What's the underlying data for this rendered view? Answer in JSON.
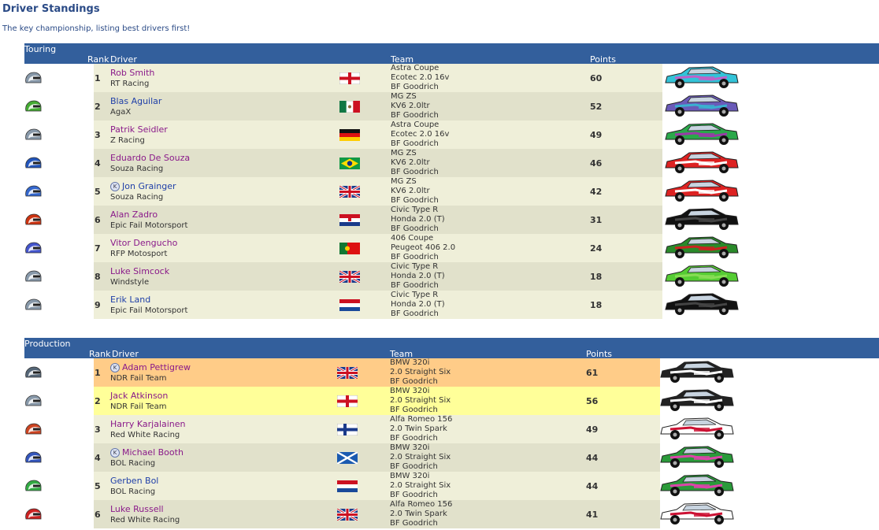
{
  "page": {
    "title": "Driver Standings",
    "subtitle": "The key championship, listing best drivers first!"
  },
  "columns": {
    "rank": "Rank",
    "driver": "Driver",
    "team": "Team",
    "points": "Points"
  },
  "colors": {
    "header": "#335f9c",
    "row_light": "#efefd9",
    "row_dark": "#e1e1cb",
    "leader": "#ffcc88",
    "second": "#ffff99",
    "name_purple": "#8a1a8a",
    "name_blue": "#1f3fa8"
  },
  "sections": [
    {
      "name": "Touring",
      "drivers": [
        {
          "rank": "1",
          "name": "Rob Smith",
          "team": "RT Racing",
          "flag": "england",
          "car": [
            "Astra Coupe",
            "Ecotec 2.0 16v",
            "BF Goodrich"
          ],
          "points": "60",
          "badge": false,
          "helmet": "#8899aa",
          "livery": [
            "#33c3d8",
            "#c060c8"
          ],
          "bg": "#efefd9",
          "name_color": "purple"
        },
        {
          "rank": "2",
          "name": "Blas Aguilar",
          "team": "AgaX",
          "flag": "mexico",
          "car": [
            "MG ZS",
            "KV6 2.0ltr",
            "BF Goodrich"
          ],
          "points": "52",
          "badge": false,
          "helmet": "#44aa33",
          "livery": [
            "#6a5ab8",
            "#3ab0d0"
          ],
          "bg": "#e1e1cb",
          "name_color": "blue"
        },
        {
          "rank": "3",
          "name": "Patrik Seidler",
          "team": "Z Racing",
          "flag": "germany",
          "car": [
            "Astra Coupe",
            "Ecotec 2.0 16v",
            "BF Goodrich"
          ],
          "points": "49",
          "badge": false,
          "helmet": "#8899aa",
          "livery": [
            "#2aa84a",
            "#9a3aa8"
          ],
          "bg": "#efefd9",
          "name_color": "purple"
        },
        {
          "rank": "4",
          "name": "Eduardo De Souza",
          "team": "Souza Racing",
          "flag": "brazil",
          "car": [
            "MG ZS",
            "KV6 2.0ltr",
            "BF Goodrich"
          ],
          "points": "46",
          "badge": false,
          "helmet": "#2255bb",
          "livery": [
            "#dd2222",
            "#ffffff"
          ],
          "bg": "#e1e1cb",
          "name_color": "purple"
        },
        {
          "rank": "5",
          "name": "Jon Grainger",
          "team": "Souza Racing",
          "flag": "uk",
          "car": [
            "MG ZS",
            "KV6 2.0ltr",
            "BF Goodrich"
          ],
          "points": "42",
          "badge": true,
          "helmet": "#3366cc",
          "livery": [
            "#dd2222",
            "#ffffff"
          ],
          "bg": "#efefd9",
          "name_color": "blue"
        },
        {
          "rank": "6",
          "name": "Alan Zadro",
          "team": "Epic Fail Motorsport",
          "flag": "croatia",
          "car": [
            "Civic Type R",
            "Honda 2.0 (T)",
            "BF Goodrich"
          ],
          "points": "31",
          "badge": false,
          "helmet": "#cc3311",
          "livery": [
            "#111111",
            "#444444"
          ],
          "bg": "#e1e1cb",
          "name_color": "purple"
        },
        {
          "rank": "7",
          "name": "Vitor Dengucho",
          "team": "RFP Motosport",
          "flag": "portugal",
          "car": [
            "406 Coupe",
            "Peugeot 406 2.0",
            "BF Goodrich"
          ],
          "points": "24",
          "badge": false,
          "helmet": "#4455cc",
          "livery": [
            "#2a8a2a",
            "#cc2222"
          ],
          "bg": "#efefd9",
          "name_color": "purple"
        },
        {
          "rank": "8",
          "name": "Luke Simcock",
          "team": "Windstyle",
          "flag": "uk",
          "car": [
            "Civic Type R",
            "Honda 2.0 (T)",
            "BF Goodrich"
          ],
          "points": "18",
          "badge": false,
          "helmet": "#8899aa",
          "livery": [
            "#55cc33",
            "#88dd55"
          ],
          "bg": "#e1e1cb",
          "name_color": "purple"
        },
        {
          "rank": "9",
          "name": "Erik Land",
          "team": "Epic Fail Motorsport",
          "flag": "netherlands",
          "car": [
            "Civic Type R",
            "Honda 2.0 (T)",
            "BF Goodrich"
          ],
          "points": "18",
          "badge": false,
          "helmet": "#8899aa",
          "livery": [
            "#111111",
            "#444444"
          ],
          "bg": "#efefd9",
          "name_color": "blue"
        }
      ]
    },
    {
      "name": "Production",
      "drivers": [
        {
          "rank": "1",
          "name": "Adam Pettigrew",
          "team": "NDR Fail Team",
          "flag": "uk",
          "car": [
            "BMW 320i",
            "2.0 Straight Six",
            "BF Goodrich"
          ],
          "points": "61",
          "badge": true,
          "helmet": "#556677",
          "livery": [
            "#222222",
            "#ffffff"
          ],
          "bg": "#ffcc88",
          "name_color": "purple"
        },
        {
          "rank": "2",
          "name": "Jack Atkinson",
          "team": "NDR Fail Team",
          "flag": "england",
          "car": [
            "BMW 320i",
            "2.0 Straight Six",
            "BF Goodrich"
          ],
          "points": "56",
          "badge": false,
          "helmet": "#8899aa",
          "livery": [
            "#222222",
            "#ffffff"
          ],
          "bg": "#ffff99",
          "name_color": "purple"
        },
        {
          "rank": "3",
          "name": "Harry Karjalainen",
          "team": "Red White Racing",
          "flag": "finland",
          "car": [
            "Alfa Romeo 156",
            "2.0 Twin Spark",
            "BF Goodrich"
          ],
          "points": "49",
          "badge": false,
          "helmet": "#cc4422",
          "livery": [
            "#ffffff",
            "#cc1133"
          ],
          "bg": "#efefd9",
          "name_color": "purple"
        },
        {
          "rank": "4",
          "name": "Michael Booth",
          "team": "BOL Racing",
          "flag": "scotland",
          "car": [
            "BMW 320i",
            "2.0 Straight Six",
            "BF Goodrich"
          ],
          "points": "44",
          "badge": true,
          "helmet": "#3355bb",
          "livery": [
            "#2a9a3a",
            "#dd44aa"
          ],
          "bg": "#e1e1cb",
          "name_color": "purple"
        },
        {
          "rank": "5",
          "name": "Gerben Bol",
          "team": "BOL Racing",
          "flag": "netherlands",
          "car": [
            "BMW 320i",
            "2.0 Straight Six",
            "BF Goodrich"
          ],
          "points": "44",
          "badge": false,
          "helmet": "#33aa44",
          "livery": [
            "#2a9a3a",
            "#dd44aa"
          ],
          "bg": "#efefd9",
          "name_color": "blue"
        },
        {
          "rank": "6",
          "name": "Luke Russell",
          "team": "Red White Racing",
          "flag": "uk",
          "car": [
            "Alfa Romeo 156",
            "2.0 Twin Spark",
            "BF Goodrich"
          ],
          "points": "41",
          "badge": false,
          "helmet": "#cc2222",
          "livery": [
            "#ffffff",
            "#cc1133"
          ],
          "bg": "#e1e1cb",
          "name_color": "purple"
        }
      ]
    }
  ]
}
